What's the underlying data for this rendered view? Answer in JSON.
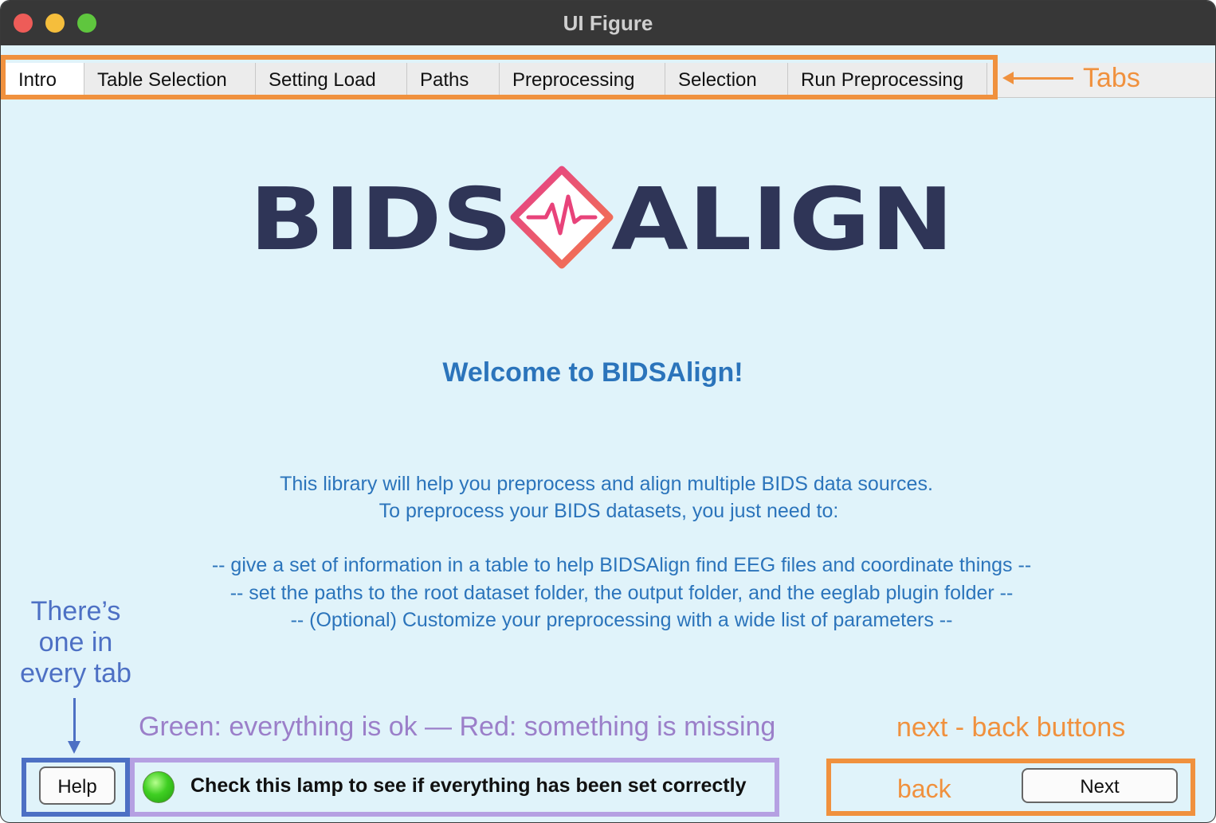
{
  "window": {
    "title": "UI Figure"
  },
  "tabs": [
    {
      "label": "Intro",
      "active": true
    },
    {
      "label": "Table Selection",
      "active": false
    },
    {
      "label": "Setting Load",
      "active": false
    },
    {
      "label": "Paths",
      "active": false
    },
    {
      "label": "Preprocessing",
      "active": false
    },
    {
      "label": "Selection",
      "active": false
    },
    {
      "label": "Run Preprocessing",
      "active": false
    }
  ],
  "annotations": {
    "tabs": "Tabs",
    "help": [
      "There’s",
      "one in",
      "every tab"
    ],
    "lamp": "Green: everything is ok — Red: something is missing",
    "nav": "next - back buttons"
  },
  "logo": {
    "left_text": "BIDS",
    "right_text": "ALIGN"
  },
  "intro": {
    "welcome": "Welcome to BIDSAlign!",
    "lines": [
      "This library will help you preprocess and align multiple BIDS data sources.",
      "To preprocess your BIDS datasets, you just need to:",
      "-- give a set of information in a table to help BIDSAlign find EEG files and coordinate things --",
      "-- set the paths to the root dataset folder, the output folder, and the eeglab plugin folder --",
      "-- (Optional) Customize your preprocessing with a wide list of parameters --"
    ]
  },
  "footer": {
    "help_label": "Help",
    "lamp_label": "Check this lamp to see if everything has been set correctly",
    "lamp_status": "green",
    "back_label": "back",
    "next_label": "Next"
  },
  "colors": {
    "background": "#e0f3fa",
    "text_blue": "#2b74bb",
    "annotation_orange": "#f0913e",
    "annotation_blue": "#4d70c4",
    "annotation_purple": "#9b7fc9",
    "logo_navy": "#2f3557",
    "logo_accent": "#e8437a"
  }
}
